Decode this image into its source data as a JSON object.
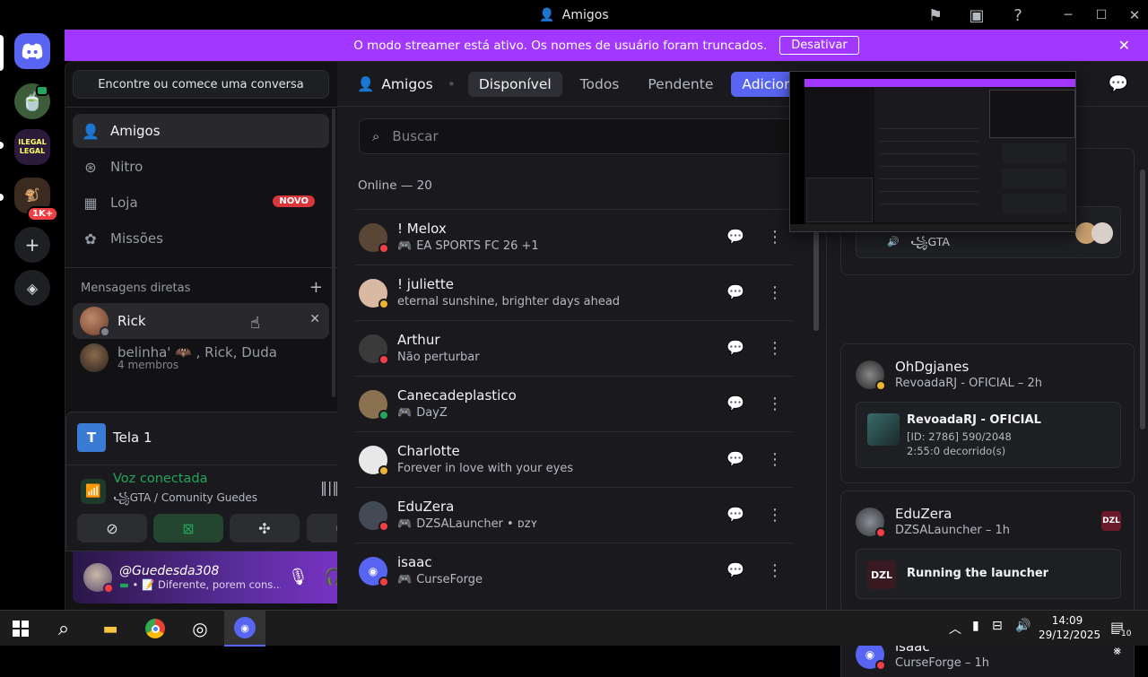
{
  "window": {
    "title": "Amigos"
  },
  "banner": {
    "text": "O modo streamer está ativo. Os nomes de usuário foram truncados.",
    "button": "Desativar"
  },
  "rail": {
    "dm_badge": "1K+"
  },
  "sidebar": {
    "find_placeholder": "Encontre ou comece uma conversa",
    "nav": [
      {
        "label": "Amigos",
        "icon": "friends-icon"
      },
      {
        "label": "Nitro",
        "icon": "nitro-icon"
      },
      {
        "label": "Loja",
        "icon": "shop-icon",
        "badge": "NOVO"
      },
      {
        "label": "Missões",
        "icon": "quests-icon"
      }
    ],
    "dm_header": "Mensagens diretas",
    "dms": [
      {
        "name": "Rick"
      },
      {
        "name": "belinha' 🦇 , Rick, Duda",
        "sub": "4 membros"
      }
    ]
  },
  "voice": {
    "screen_label": "Tela 1",
    "status": "Voz conectada",
    "channel": "꧁GTA / Comunity Guedes"
  },
  "user": {
    "name": "@Guedesda308",
    "status": "📝 Diferente, porem cons..."
  },
  "topbar": {
    "title": "Amigos",
    "tabs": [
      "Disponível",
      "Todos",
      "Pendente"
    ],
    "add_label": "Adicionar"
  },
  "search": {
    "placeholder": "Buscar"
  },
  "online_header": "Online — 20",
  "friends": [
    {
      "name": "! Melox",
      "activity": "EA SPORTS FC 26 +1",
      "game": true,
      "status": "dnd",
      "avc": "#5a4636"
    },
    {
      "name": "! juliette",
      "activity": "eternal sunshine, brighter days ahead",
      "game": false,
      "status": "idle",
      "avc": "#d9b9a2"
    },
    {
      "name": "Arthur",
      "activity": "Não perturbar",
      "game": false,
      "status": "dnd",
      "avc": "#3a3a3a"
    },
    {
      "name": "Canecadeplastico",
      "activity": "DayZ",
      "game": true,
      "status": "online",
      "avc": "#8a7250"
    },
    {
      "name": "Charlotte",
      "activity": "Forever in love with your eyes",
      "game": false,
      "status": "idle",
      "avc": "#e8e8e8"
    },
    {
      "name": "EduZera",
      "activity": "DZSALauncher • ᴅᴢʏ",
      "game": true,
      "status": "dnd",
      "avc": "#444a55"
    },
    {
      "name": "isaac",
      "activity": "CurseForge",
      "game": true,
      "status": "dnd",
      "avc": "#5865f2"
    }
  ],
  "activity": {
    "first_card_sub": "꧁GTA",
    "cards": [
      {
        "name": "OhDgjanes",
        "sub": "RevoadaRJ - OFICIAL – 2h",
        "inner_title": "RevoadaRJ - OFICIAL",
        "inner_l1": "[ID: 2786] 590/2048",
        "inner_l2": "2:55:0 decorrido(s)"
      },
      {
        "name": "EduZera",
        "sub": "DZSALauncher – 1h",
        "inner_title": "Running the launcher",
        "logo": "DZL"
      },
      {
        "name": "isaac",
        "sub": "CurseForge – 1h"
      }
    ]
  },
  "taskbar": {
    "time": "14:09",
    "date": "29/12/2025",
    "notif": "10"
  },
  "colors": {
    "accent": "#5865f2",
    "streamer": "#a238ff",
    "online": "#23a55a",
    "dnd": "#f23f43",
    "idle": "#f0b232"
  }
}
